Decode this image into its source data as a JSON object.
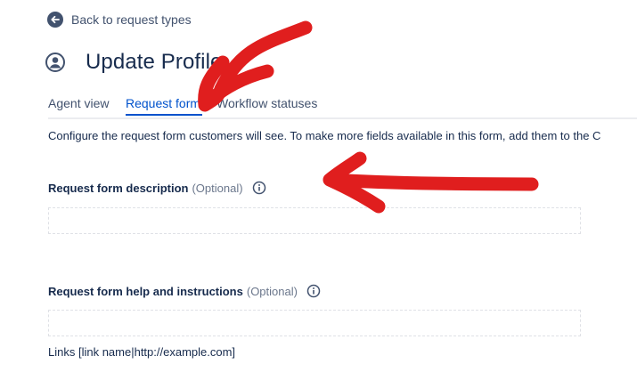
{
  "back_link": {
    "label": "Back to request types",
    "icon": "arrow-left-circle-icon"
  },
  "header": {
    "title": "Update Profile",
    "icon": "user-circle-icon"
  },
  "tabs": [
    {
      "label": "Agent view",
      "active": false
    },
    {
      "label": "Request form",
      "active": true
    },
    {
      "label": "Workflow statuses",
      "active": false
    }
  ],
  "intro_text": "Configure the request form customers will see. To make more fields available in this form, add them to the C",
  "fields": {
    "description": {
      "label": "Request form description",
      "optional": "(Optional)",
      "icon": "info-icon",
      "value": ""
    },
    "help": {
      "label": "Request form help and instructions",
      "optional": "(Optional)",
      "icon": "info-icon",
      "value": "",
      "helper_text": "Links [link name|http://example.com]"
    }
  },
  "colors": {
    "accent": "#0052CC",
    "text": "#172B4D",
    "muted": "#6B778C",
    "annotation_red": "#E01E1E"
  }
}
